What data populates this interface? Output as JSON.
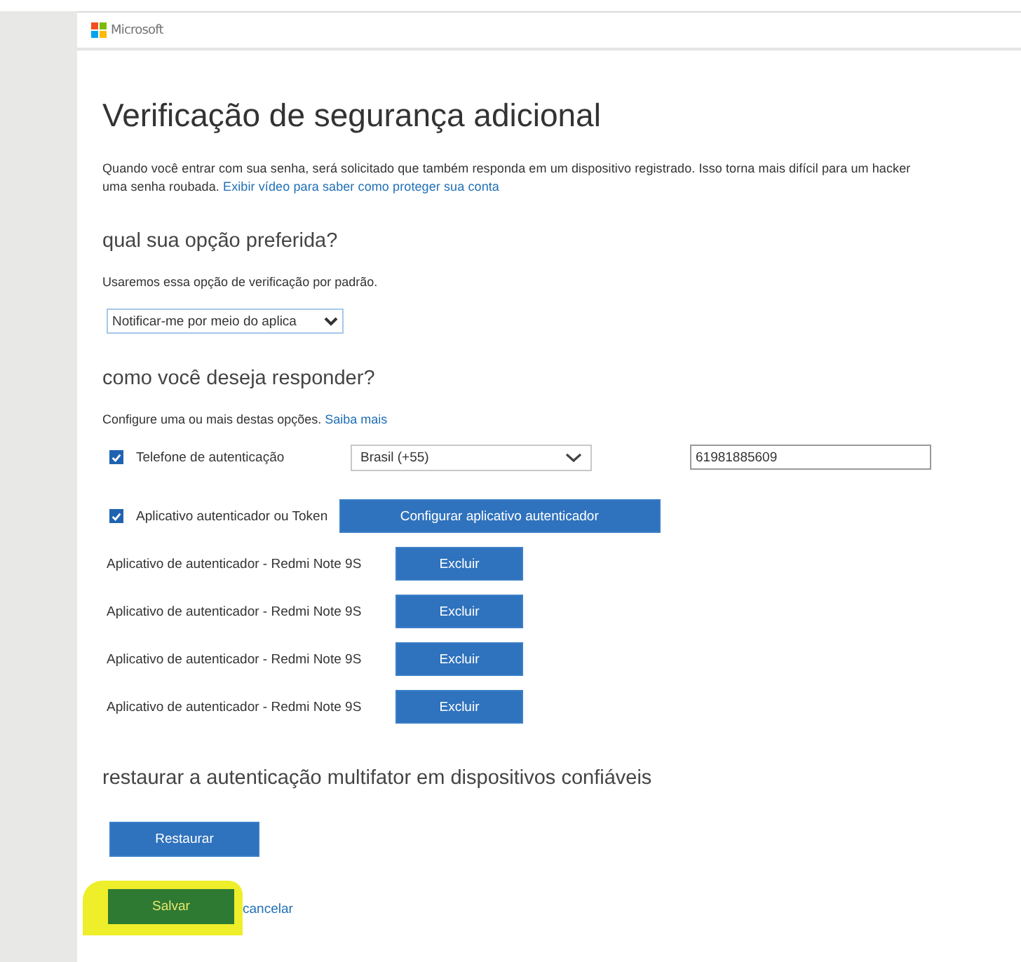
{
  "header": {
    "brand": "Microsoft"
  },
  "title": "Verificação de segurança adicional",
  "intro": {
    "lines": [
      "Quando você entrar com sua senha, será solicitado que também responda em um dispositivo registrado. Isso torna mais difícil para um hacker",
      "uma senha roubada."
    ],
    "link": "Exibir vídeo para saber como proteger sua conta"
  },
  "preferred": {
    "heading": "qual sua opção preferida?",
    "hint": "Usaremos essa opção de verificação por padrão.",
    "select": "Notificar-me por meio do aplica"
  },
  "respond": {
    "heading": "como você deseja responder?",
    "hint": "Configure uma ou mais destas opções.",
    "link": "Saiba mais",
    "phone": {
      "label": "Telefone de autenticação",
      "checked": true,
      "country": "Brasil (+55)",
      "number": "61981885609"
    },
    "app": {
      "label": "Aplicativo autenticador ou Token",
      "checked": true,
      "button": "Configurar aplicativo autenticador"
    },
    "devices": [
      {
        "name": "Aplicativo de autenticador - Redmi Note 9S",
        "button": "Excluir"
      },
      {
        "name": "Aplicativo de autenticador - Redmi Note 9S",
        "button": "Excluir"
      },
      {
        "name": "Aplicativo de autenticador - Redmi Note 9S",
        "button": "Excluir"
      },
      {
        "name": "Aplicativo de autenticador - Redmi Note 9S",
        "button": "Excluir"
      }
    ]
  },
  "restore": {
    "heading": "restaurar a autenticação multifator em dispositivos confiáveis",
    "button": "Restaurar"
  },
  "actions": {
    "save": "Salvar",
    "cancel": "cancelar",
    "save_highlighted": true
  }
}
